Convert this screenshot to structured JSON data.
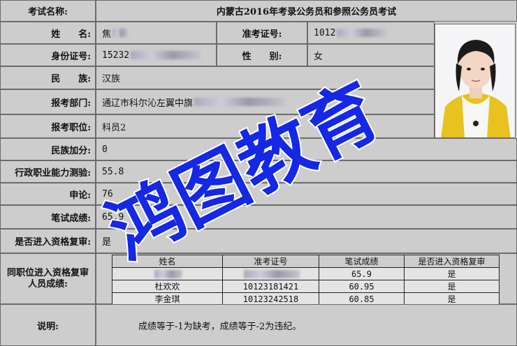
{
  "exam_name": {
    "label": "考试名称:",
    "value": "内蒙古2016年考录公务员和参照公务员考试"
  },
  "name": {
    "label": "姓　　名:",
    "value": "焦"
  },
  "ticket": {
    "label": "准考证号:",
    "value": "1012"
  },
  "id_card": {
    "label": "身份证号:",
    "value": "15232"
  },
  "gender": {
    "label": "性　　别:",
    "value": "女"
  },
  "ethnicity": {
    "label": "民　　族:",
    "value": "汉族"
  },
  "department": {
    "label": "报考部门:",
    "value": "通辽市科尔沁左翼中旗"
  },
  "position": {
    "label": "报考职位:",
    "value": "科员2"
  },
  "ethnic_bonus": {
    "label": "民族加分:",
    "value": "0"
  },
  "aptitude": {
    "label": "行政职业能力测验:",
    "value": "55.8"
  },
  "essay": {
    "label": "申论:",
    "value": "76"
  },
  "written": {
    "label": "笔试成绩:",
    "value": "65.9"
  },
  "review": {
    "label": "是否进入资格复审:",
    "value": "是"
  },
  "peers": {
    "label_line1": "同职位进入资格复审",
    "label_line2": "人员成绩:",
    "headers": [
      "姓名",
      "准考证号",
      "笔试成绩",
      "是否进入资格复审"
    ],
    "rows": [
      {
        "name": "",
        "ticket": "",
        "score": "65.9",
        "review": "是"
      },
      {
        "name": "杜欢欢",
        "ticket": "10123181421",
        "score": "60.95",
        "review": "是"
      },
      {
        "name": "李金琪",
        "ticket": "10123242518",
        "score": "60.85",
        "review": "是"
      }
    ]
  },
  "note": {
    "label": "说明:",
    "value": "成绩等于-1为缺考，成绩等于-2为违纪。"
  },
  "watermark": {
    "text": "鸿图教育",
    "color": "#1428e6"
  },
  "colors": {
    "cell_bg": "#cdcdcd",
    "border": "#6b6b6b",
    "photo_jacket": "#e8c21e"
  }
}
